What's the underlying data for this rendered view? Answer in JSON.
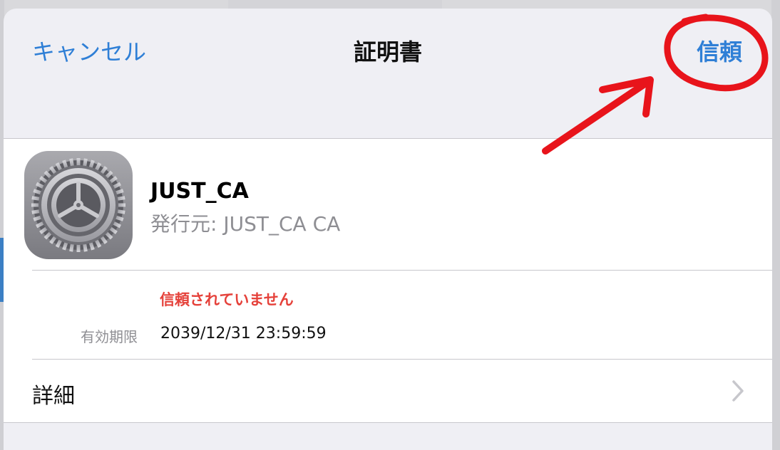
{
  "navbar": {
    "cancel_label": "キャンセル",
    "title": "証明書",
    "trust_label": "信頼"
  },
  "certificate": {
    "name": "JUST_CA",
    "issuer_label": "発行元:",
    "issuer_value": "JUST_CA CA",
    "status": "信頼されていません",
    "expiry_label": "有効期限",
    "expiry_value": "2039/12/31 23:59:59",
    "icon": "settings-gear-icon"
  },
  "details": {
    "label": "詳細"
  },
  "colors": {
    "accent": "#2f7fd6",
    "warning": "#e5413a",
    "annotation": "#e8141b"
  }
}
